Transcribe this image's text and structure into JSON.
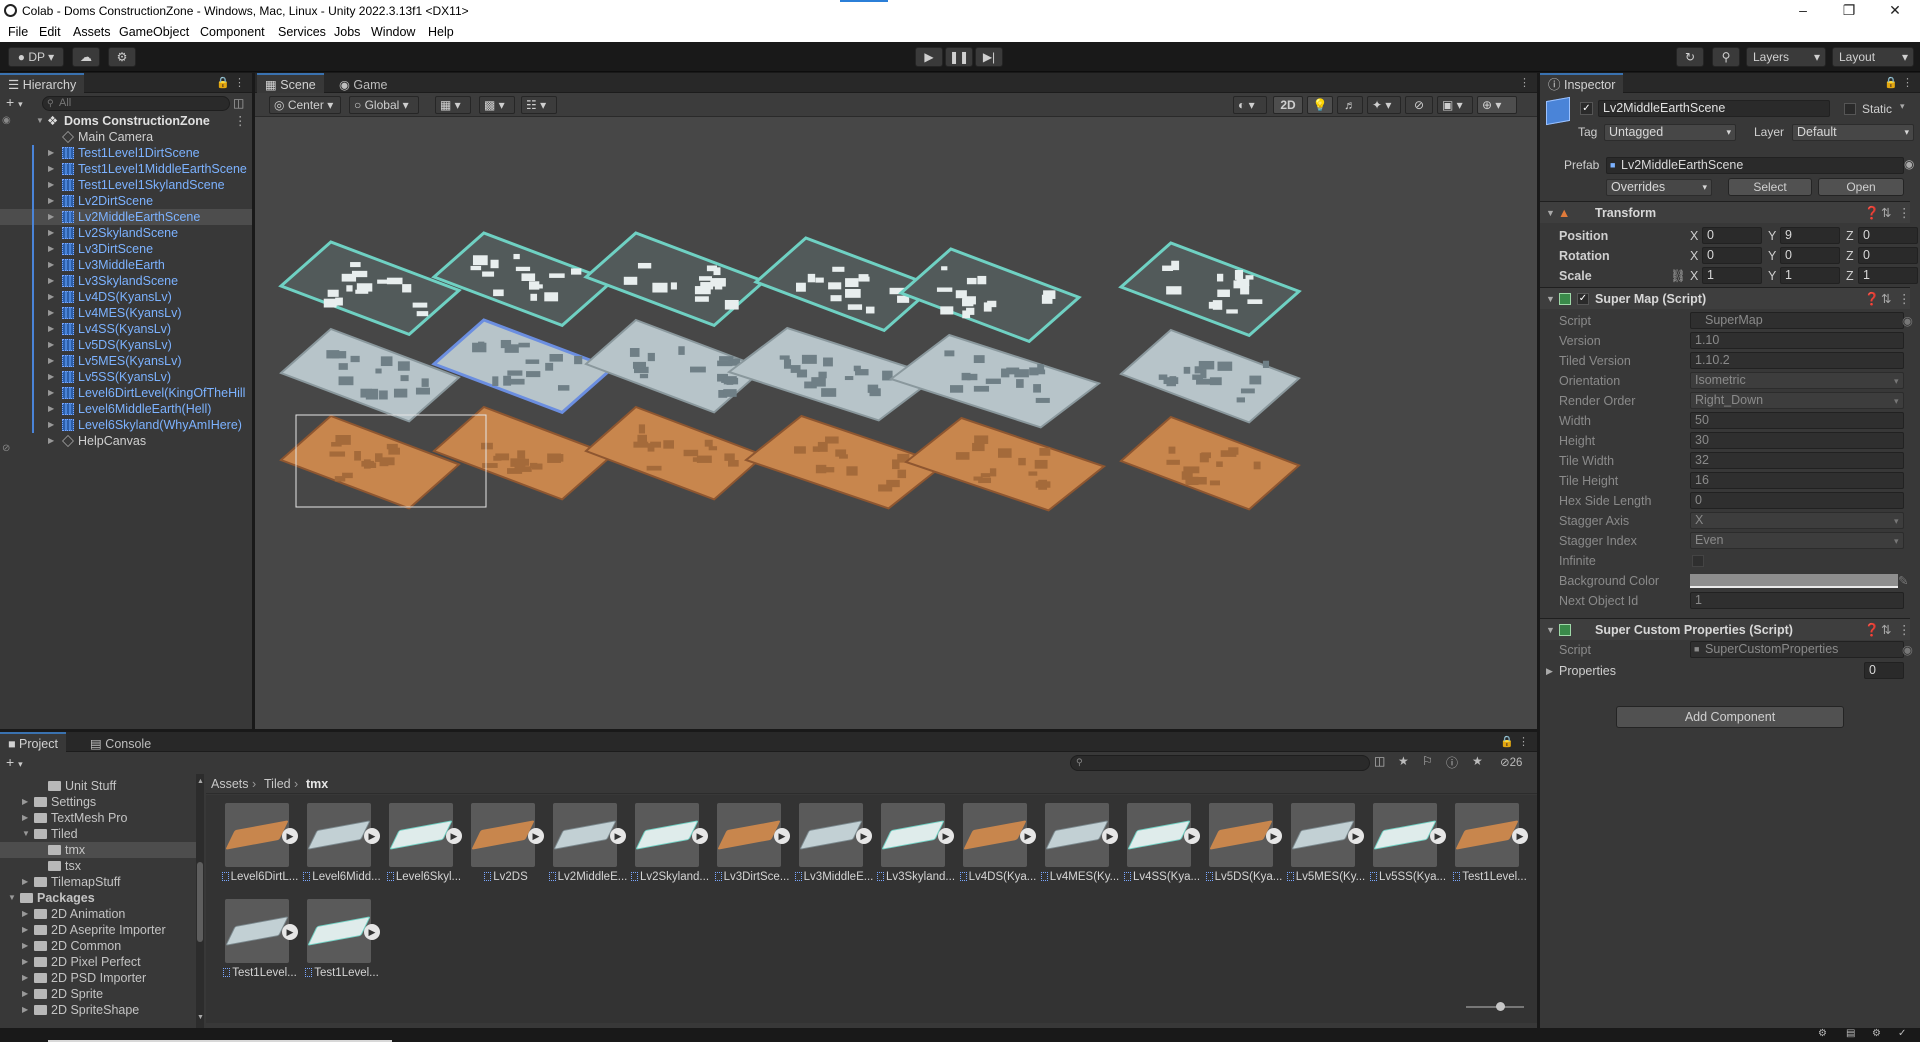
{
  "window": {
    "title": "Colab - Doms ConstructionZone - Windows, Mac, Linux - Unity 2022.3.13f1 <DX11>"
  },
  "menu": [
    "File",
    "Edit",
    "Assets",
    "GameObject",
    "Component",
    "Services",
    "Jobs",
    "Window",
    "Help"
  ],
  "toolbar": {
    "account": "DP",
    "layers": "Layers",
    "layout": "Layout"
  },
  "hierarchy": {
    "tab": "Hierarchy",
    "search_placeholder": "All",
    "scene": "Doms ConstructionZone",
    "items": [
      {
        "label": "Main Camera",
        "type": "object",
        "expandable": false
      },
      {
        "label": "Test1Level1DirtScene",
        "type": "prefab",
        "expandable": true
      },
      {
        "label": "Test1Level1MiddleEarthScene",
        "type": "prefab",
        "expandable": true
      },
      {
        "label": "Test1Level1SkylandScene",
        "type": "prefab",
        "expandable": true
      },
      {
        "label": "Lv2DirtScene",
        "type": "prefab",
        "expandable": true
      },
      {
        "label": "Lv2MiddleEarthScene",
        "type": "prefab",
        "expandable": true,
        "selected": true
      },
      {
        "label": "Lv2SkylandScene",
        "type": "prefab",
        "expandable": true
      },
      {
        "label": "Lv3DirtScene",
        "type": "prefab",
        "expandable": true
      },
      {
        "label": "Lv3MiddleEarth",
        "type": "prefab",
        "expandable": true
      },
      {
        "label": "Lv3SkylandScene",
        "type": "prefab",
        "expandable": true
      },
      {
        "label": "Lv4DS(KyansLv)",
        "type": "prefab",
        "expandable": true
      },
      {
        "label": "Lv4MES(KyansLv)",
        "type": "prefab",
        "expandable": true
      },
      {
        "label": "Lv4SS(KyansLv)",
        "type": "prefab",
        "expandable": true
      },
      {
        "label": "Lv5DS(KyansLv)",
        "type": "prefab",
        "expandable": true
      },
      {
        "label": "Lv5MES(KyansLv)",
        "type": "prefab",
        "expandable": true
      },
      {
        "label": "Lv5SS(KyansLv)",
        "type": "prefab",
        "expandable": true
      },
      {
        "label": "Level6DirtLevel(KingOfTheHill",
        "type": "prefab",
        "expandable": true
      },
      {
        "label": "Level6MiddleEarth(Hell)",
        "type": "prefab",
        "expandable": true
      },
      {
        "label": "Level6Skyland(WhyAmIHere)",
        "type": "prefab",
        "expandable": true
      },
      {
        "label": "HelpCanvas",
        "type": "object",
        "expandable": true
      }
    ]
  },
  "scene": {
    "tabs": [
      "Scene",
      "Game"
    ],
    "pivot": "Center",
    "space": "Global",
    "mode_2d": "2D"
  },
  "inspector": {
    "tab": "Inspector",
    "object_name": "Lv2MiddleEarthScene",
    "static_label": "Static",
    "tag_label": "Tag",
    "tag": "Untagged",
    "layer_label": "Layer",
    "layer": "Default",
    "prefab_label": "Prefab",
    "prefab": "Lv2MiddleEarthScene",
    "overrides": "Overrides",
    "select": "Select",
    "open": "Open",
    "transform": {
      "title": "Transform",
      "position_label": "Position",
      "position": [
        "0",
        "9",
        "0"
      ],
      "rotation_label": "Rotation",
      "rotation": [
        "0",
        "0",
        "0"
      ],
      "scale_label": "Scale",
      "scale": [
        "1",
        "1",
        "1"
      ]
    },
    "supermap": {
      "title": "Super Map (Script)",
      "fields": [
        {
          "label": "Script",
          "value": "SuperMap",
          "kind": "object"
        },
        {
          "label": "Version",
          "value": "1.10",
          "kind": "text"
        },
        {
          "label": "Tiled Version",
          "value": "1.10.2",
          "kind": "text"
        },
        {
          "label": "Orientation",
          "value": "Isometric",
          "kind": "dropdown"
        },
        {
          "label": "Render Order",
          "value": "Right_Down",
          "kind": "dropdown"
        },
        {
          "label": "Width",
          "value": "50",
          "kind": "text"
        },
        {
          "label": "Height",
          "value": "30",
          "kind": "text"
        },
        {
          "label": "Tile Width",
          "value": "32",
          "kind": "text"
        },
        {
          "label": "Tile Height",
          "value": "16",
          "kind": "text"
        },
        {
          "label": "Hex Side Length",
          "value": "0",
          "kind": "text"
        },
        {
          "label": "Stagger Axis",
          "value": "X",
          "kind": "dropdown"
        },
        {
          "label": "Stagger Index",
          "value": "Even",
          "kind": "dropdown"
        },
        {
          "label": "Infinite",
          "value": "",
          "kind": "checkbox"
        },
        {
          "label": "Background Color",
          "value": "",
          "kind": "color"
        },
        {
          "label": "Next Object Id",
          "value": "1",
          "kind": "text"
        }
      ]
    },
    "custom_props": {
      "title": "Super Custom Properties (Script)",
      "script_label": "Script",
      "script": "SuperCustomProperties",
      "properties_label": "Properties",
      "properties_count": "0"
    },
    "add_component": "Add Component"
  },
  "project": {
    "tabs": [
      "Project",
      "Console"
    ],
    "asset_count": "26",
    "breadcrumb": [
      "Assets",
      "Tiled",
      "tmx"
    ],
    "tree": [
      {
        "label": "Unit Stuff",
        "indent": 2,
        "arrow": ""
      },
      {
        "label": "Settings",
        "indent": 1,
        "arrow": "▶"
      },
      {
        "label": "TextMesh Pro",
        "indent": 1,
        "arrow": "▶"
      },
      {
        "label": "Tiled",
        "indent": 1,
        "arrow": "▼"
      },
      {
        "label": "tmx",
        "indent": 2,
        "arrow": "",
        "selected": true
      },
      {
        "label": "tsx",
        "indent": 2,
        "arrow": ""
      },
      {
        "label": "TilemapStuff",
        "indent": 1,
        "arrow": "▶"
      },
      {
        "label": "Packages",
        "indent": 0,
        "arrow": "▼",
        "bold": true
      },
      {
        "label": "2D Animation",
        "indent": 1,
        "arrow": "▶"
      },
      {
        "label": "2D Aseprite Importer",
        "indent": 1,
        "arrow": "▶"
      },
      {
        "label": "2D Common",
        "indent": 1,
        "arrow": "▶"
      },
      {
        "label": "2D Pixel Perfect",
        "indent": 1,
        "arrow": "▶"
      },
      {
        "label": "2D PSD Importer",
        "indent": 1,
        "arrow": "▶"
      },
      {
        "label": "2D Sprite",
        "indent": 1,
        "arrow": "▶"
      },
      {
        "label": "2D SpriteShape",
        "indent": 1,
        "arrow": "▶"
      }
    ],
    "assets": [
      {
        "name": "Level6DirtL...",
        "kind": "dirt"
      },
      {
        "name": "Level6Midd...",
        "kind": "mid"
      },
      {
        "name": "Level6Skyl...",
        "kind": "sky"
      },
      {
        "name": "Lv2DS",
        "kind": "dirt"
      },
      {
        "name": "Lv2MiddleE...",
        "kind": "mid"
      },
      {
        "name": "Lv2Skyland...",
        "kind": "sky"
      },
      {
        "name": "Lv3DirtSce...",
        "kind": "dirt"
      },
      {
        "name": "Lv3MiddleE...",
        "kind": "mid"
      },
      {
        "name": "Lv3Skyland...",
        "kind": "sky"
      },
      {
        "name": "Lv4DS(Kya...",
        "kind": "dirt"
      },
      {
        "name": "Lv4MES(Ky...",
        "kind": "mid"
      },
      {
        "name": "Lv4SS(Kya...",
        "kind": "sky"
      },
      {
        "name": "Lv5DS(Kya...",
        "kind": "dirt"
      },
      {
        "name": "Lv5MES(Ky...",
        "kind": "mid"
      },
      {
        "name": "Lv5SS(Kya...",
        "kind": "sky"
      },
      {
        "name": "Test1Level...",
        "kind": "dirt"
      },
      {
        "name": "Test1Level...",
        "kind": "mid"
      },
      {
        "name": "Test1Level...",
        "kind": "sky"
      }
    ]
  },
  "colors": {
    "accent": "#3a72b0",
    "prefab_text": "#7cb2ff",
    "dirt": "#c8864d",
    "middle_earth": "#c2d0d4",
    "skyland": "#6fd1c3"
  }
}
